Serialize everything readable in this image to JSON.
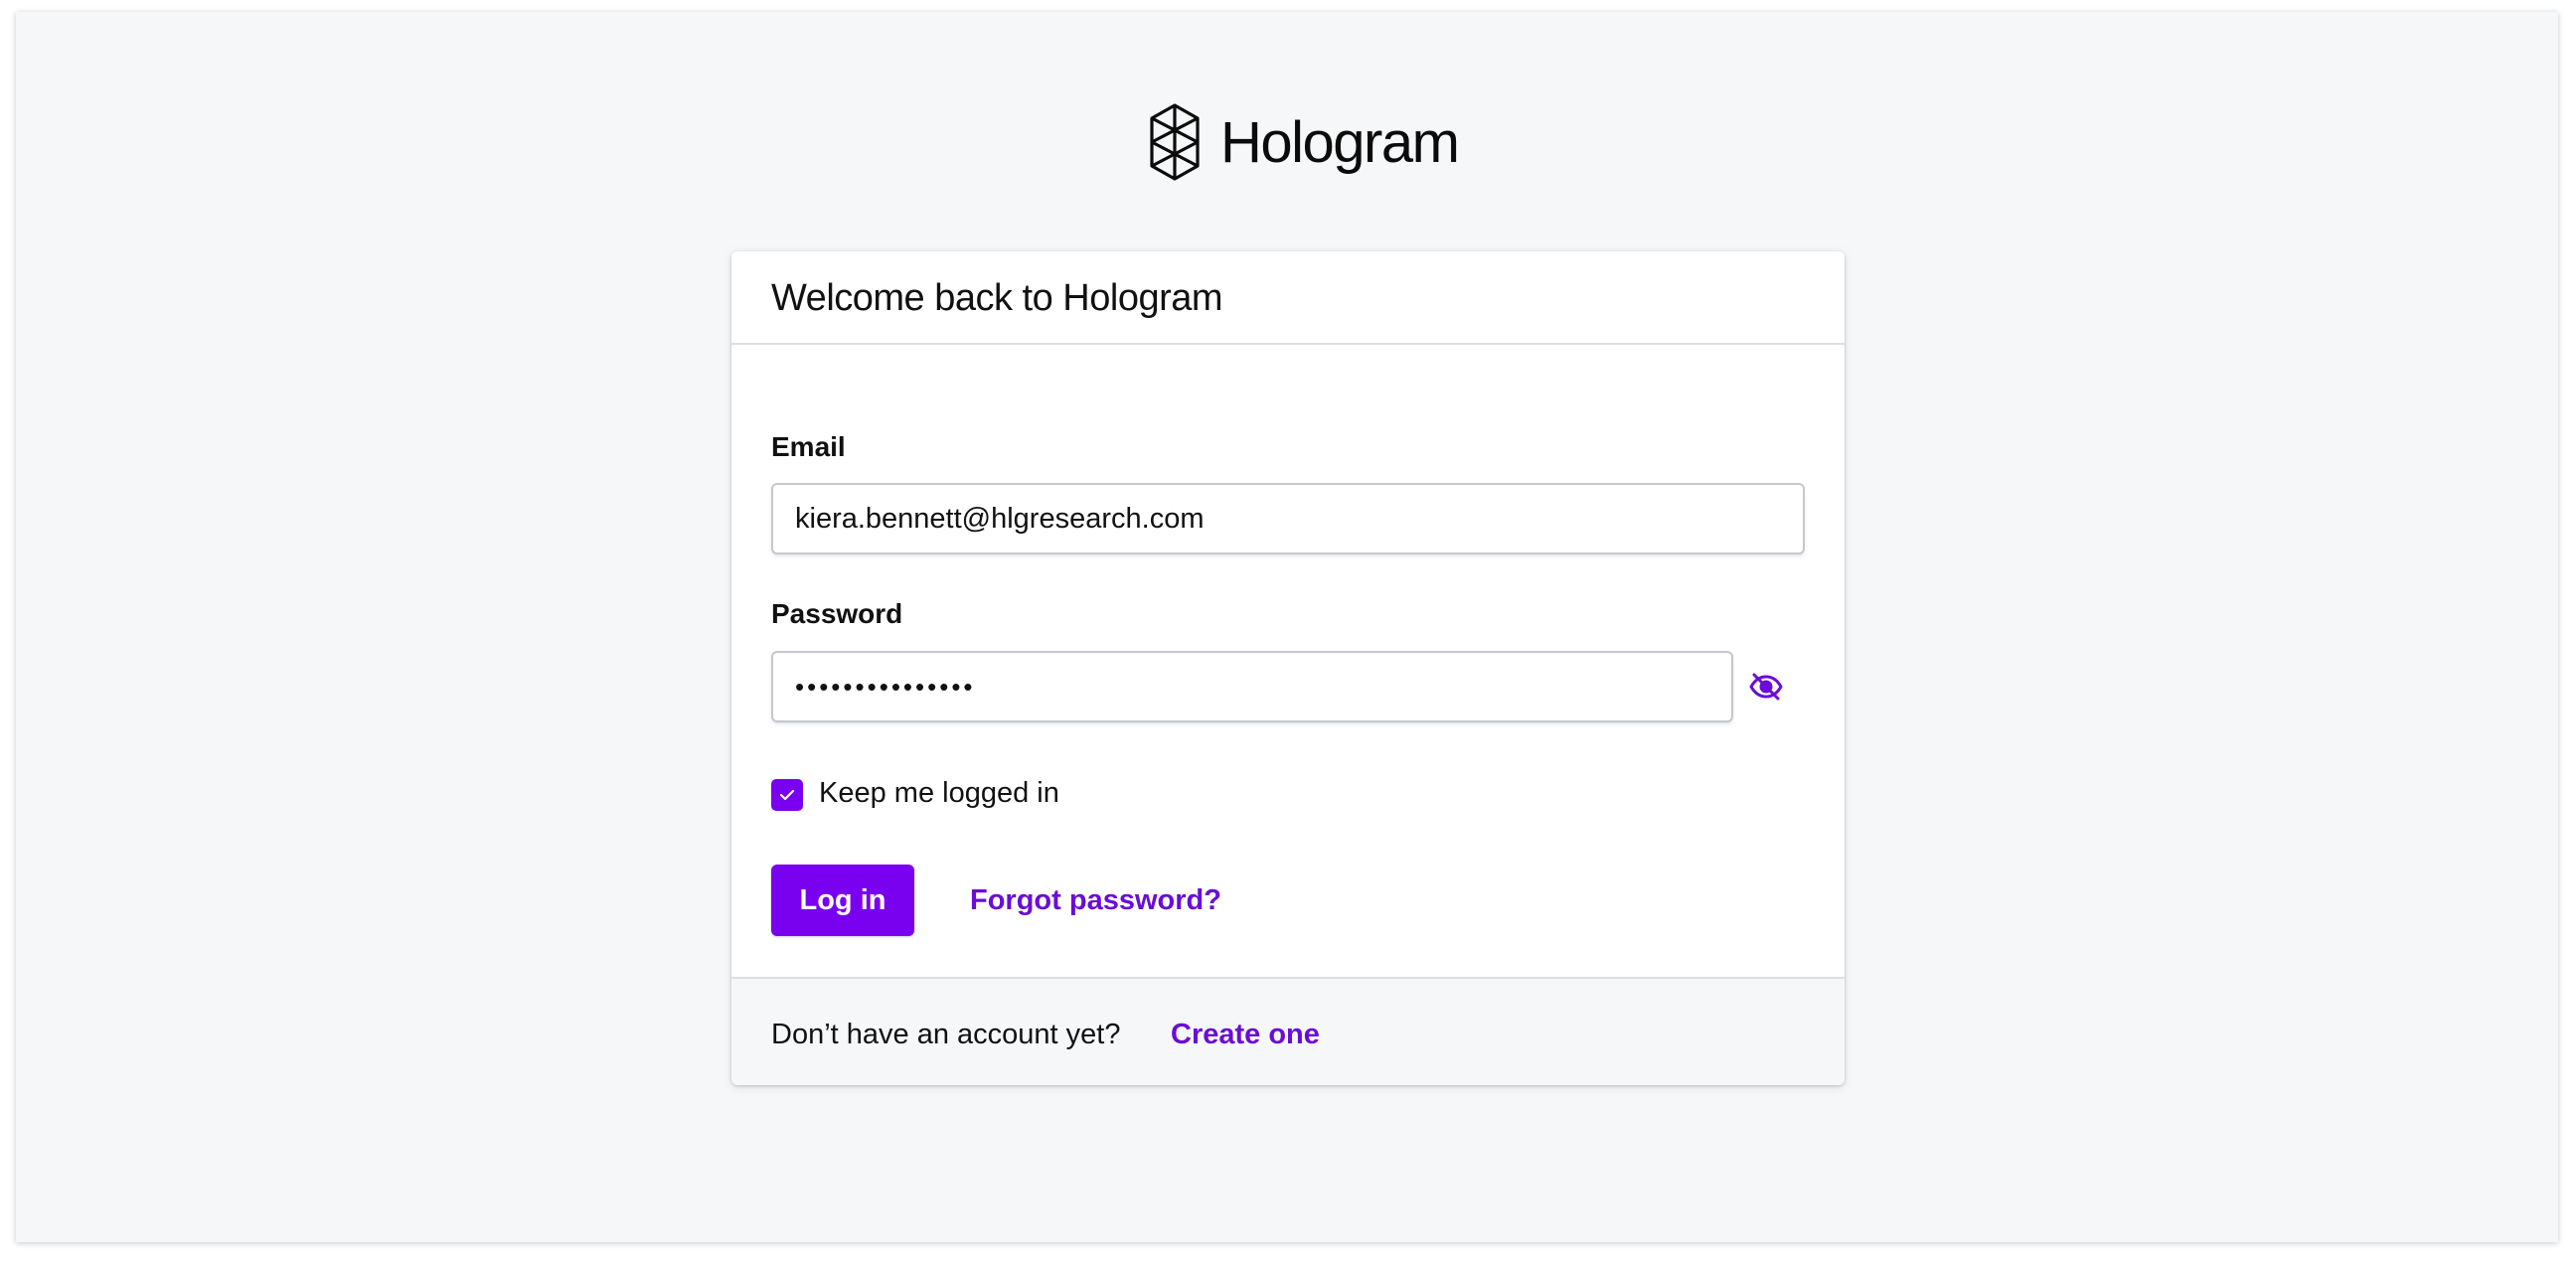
{
  "brand": {
    "name": "Hologram",
    "logo_icon": "hologram-logo-icon",
    "accent_color": "#7a00f0",
    "link_color": "#6a0dd6"
  },
  "card": {
    "title": "Welcome back to Hologram"
  },
  "form": {
    "email_label": "Email",
    "email_value": "kiera.bennett@hlgresearch.com",
    "password_label": "Password",
    "password_value": "•••••••••••••••",
    "password_toggle_icon": "eye-slash-icon",
    "keep_logged_in_label": "Keep me logged in",
    "keep_logged_in_checked": true,
    "login_button": "Log in",
    "forgot_password_link": "Forgot password?"
  },
  "footer": {
    "prompt": "Don’t have an account yet?",
    "create_link": "Create one"
  }
}
